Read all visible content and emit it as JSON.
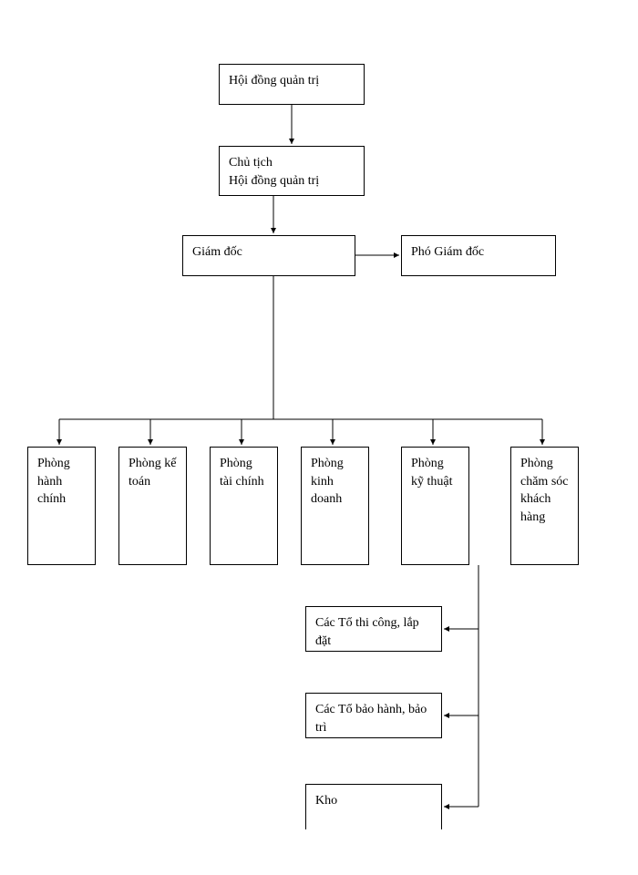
{
  "nodes": {
    "board": "Hội đồng quản trị",
    "chairman_line1": "Chủ tịch",
    "chairman_line2": "Hội đồng quản trị",
    "director": "Giám đốc",
    "deputy_director": "Phó Giám đốc",
    "dept_admin": "Phòng hành chính",
    "dept_accounting": "Phòng kế toán",
    "dept_finance": "Phòng tài chính",
    "dept_business": "Phòng kinh doanh",
    "dept_technical": "Phòng kỹ thuật",
    "dept_customer_care": "Phòng chăm sóc khách hàng",
    "team_construction": "Các Tổ thi công, lắp đặt",
    "team_warranty": "Các Tổ bảo hành, bảo trì",
    "warehouse": "Kho"
  }
}
